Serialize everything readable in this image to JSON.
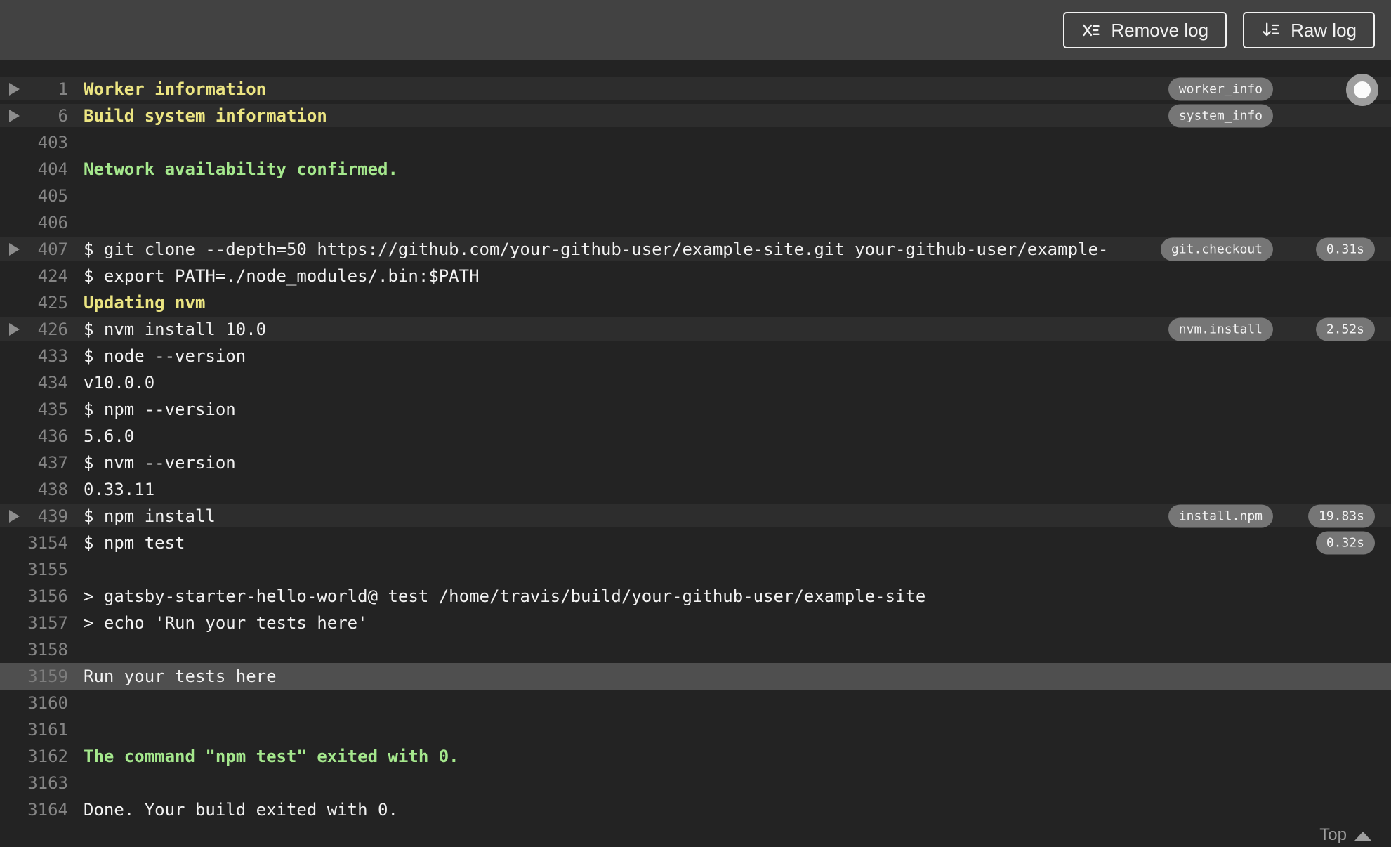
{
  "toolbar": {
    "remove_log_label": "Remove log",
    "raw_log_label": "Raw log"
  },
  "footer": {
    "top_label": "Top"
  },
  "icons": {
    "remove_log": "clear-log-x-list-icon",
    "raw_log": "download-arrow-list-icon",
    "fold": "fold-arrow-icon",
    "scroll_indicator": "scroll-position-dot-icon",
    "top": "up-arrow-icon"
  },
  "colors": {
    "header_bg": "#424242",
    "log_bg": "#232323",
    "fold_row_bg": "#2d2d2d",
    "selected_row_bg": "#4f4f4f",
    "log_text": "#f2f2f2",
    "line_number": "#858585",
    "yellow_text": "#ece582",
    "green_text": "#a5e88d",
    "badge_bg": "#767676",
    "badge_text": "#f3f3f3",
    "top_link": "#9e9e9e"
  },
  "log": {
    "lines": [
      {
        "num": "1",
        "text": "Worker information",
        "color": "yellow",
        "fold": true,
        "band": true,
        "selected": false,
        "badge": "worker_info",
        "time": null
      },
      {
        "num": "6",
        "text": "Build system information",
        "color": "yellow",
        "fold": true,
        "band": true,
        "selected": false,
        "badge": "system_info",
        "time": null
      },
      {
        "num": "403",
        "text": "",
        "color": "",
        "fold": false,
        "band": false,
        "selected": false,
        "badge": null,
        "time": null
      },
      {
        "num": "404",
        "text": "Network availability confirmed.",
        "color": "green",
        "fold": false,
        "band": false,
        "selected": false,
        "badge": null,
        "time": null
      },
      {
        "num": "405",
        "text": "",
        "color": "",
        "fold": false,
        "band": false,
        "selected": false,
        "badge": null,
        "time": null
      },
      {
        "num": "406",
        "text": "",
        "color": "",
        "fold": false,
        "band": false,
        "selected": false,
        "badge": null,
        "time": null
      },
      {
        "num": "407",
        "text": "$ git clone --depth=50 https://github.com/your-github-user/example-site.git your-github-user/example-",
        "color": "",
        "fold": true,
        "band": true,
        "selected": false,
        "badge": "git.checkout",
        "time": "0.31s"
      },
      {
        "num": "424",
        "text": "$ export PATH=./node_modules/.bin:$PATH",
        "color": "",
        "fold": false,
        "band": false,
        "selected": false,
        "badge": null,
        "time": null
      },
      {
        "num": "425",
        "text": "Updating nvm",
        "color": "yellow",
        "fold": false,
        "band": false,
        "selected": false,
        "badge": null,
        "time": null
      },
      {
        "num": "426",
        "text": "$ nvm install 10.0",
        "color": "",
        "fold": true,
        "band": true,
        "selected": false,
        "badge": "nvm.install",
        "time": "2.52s"
      },
      {
        "num": "433",
        "text": "$ node --version",
        "color": "",
        "fold": false,
        "band": false,
        "selected": false,
        "badge": null,
        "time": null
      },
      {
        "num": "434",
        "text": "v10.0.0",
        "color": "",
        "fold": false,
        "band": false,
        "selected": false,
        "badge": null,
        "time": null
      },
      {
        "num": "435",
        "text": "$ npm --version",
        "color": "",
        "fold": false,
        "band": false,
        "selected": false,
        "badge": null,
        "time": null
      },
      {
        "num": "436",
        "text": "5.6.0",
        "color": "",
        "fold": false,
        "band": false,
        "selected": false,
        "badge": null,
        "time": null
      },
      {
        "num": "437",
        "text": "$ nvm --version",
        "color": "",
        "fold": false,
        "band": false,
        "selected": false,
        "badge": null,
        "time": null
      },
      {
        "num": "438",
        "text": "0.33.11",
        "color": "",
        "fold": false,
        "band": false,
        "selected": false,
        "badge": null,
        "time": null
      },
      {
        "num": "439",
        "text": "$ npm install",
        "color": "",
        "fold": true,
        "band": true,
        "selected": false,
        "badge": "install.npm",
        "time": "19.83s"
      },
      {
        "num": "3154",
        "text": "$ npm test",
        "color": "",
        "fold": false,
        "band": false,
        "selected": false,
        "badge": null,
        "time": "0.32s"
      },
      {
        "num": "3155",
        "text": "",
        "color": "",
        "fold": false,
        "band": false,
        "selected": false,
        "badge": null,
        "time": null
      },
      {
        "num": "3156",
        "text": "> gatsby-starter-hello-world@ test /home/travis/build/your-github-user/example-site",
        "color": "",
        "fold": false,
        "band": false,
        "selected": false,
        "badge": null,
        "time": null
      },
      {
        "num": "3157",
        "text": "> echo 'Run your tests here'",
        "color": "",
        "fold": false,
        "band": false,
        "selected": false,
        "badge": null,
        "time": null
      },
      {
        "num": "3158",
        "text": "",
        "color": "",
        "fold": false,
        "band": false,
        "selected": false,
        "badge": null,
        "time": null
      },
      {
        "num": "3159",
        "text": "Run your tests here",
        "color": "",
        "fold": false,
        "band": false,
        "selected": true,
        "badge": null,
        "time": null
      },
      {
        "num": "3160",
        "text": "",
        "color": "",
        "fold": false,
        "band": false,
        "selected": false,
        "badge": null,
        "time": null
      },
      {
        "num": "3161",
        "text": "",
        "color": "",
        "fold": false,
        "band": false,
        "selected": false,
        "badge": null,
        "time": null
      },
      {
        "num": "3162",
        "text": "The command \"npm test\" exited with 0.",
        "color": "green",
        "fold": false,
        "band": false,
        "selected": false,
        "badge": null,
        "time": null
      },
      {
        "num": "3163",
        "text": "",
        "color": "",
        "fold": false,
        "band": false,
        "selected": false,
        "badge": null,
        "time": null
      },
      {
        "num": "3164",
        "text": "Done. Your build exited with 0.",
        "color": "",
        "fold": false,
        "band": false,
        "selected": false,
        "badge": null,
        "time": null
      }
    ]
  }
}
